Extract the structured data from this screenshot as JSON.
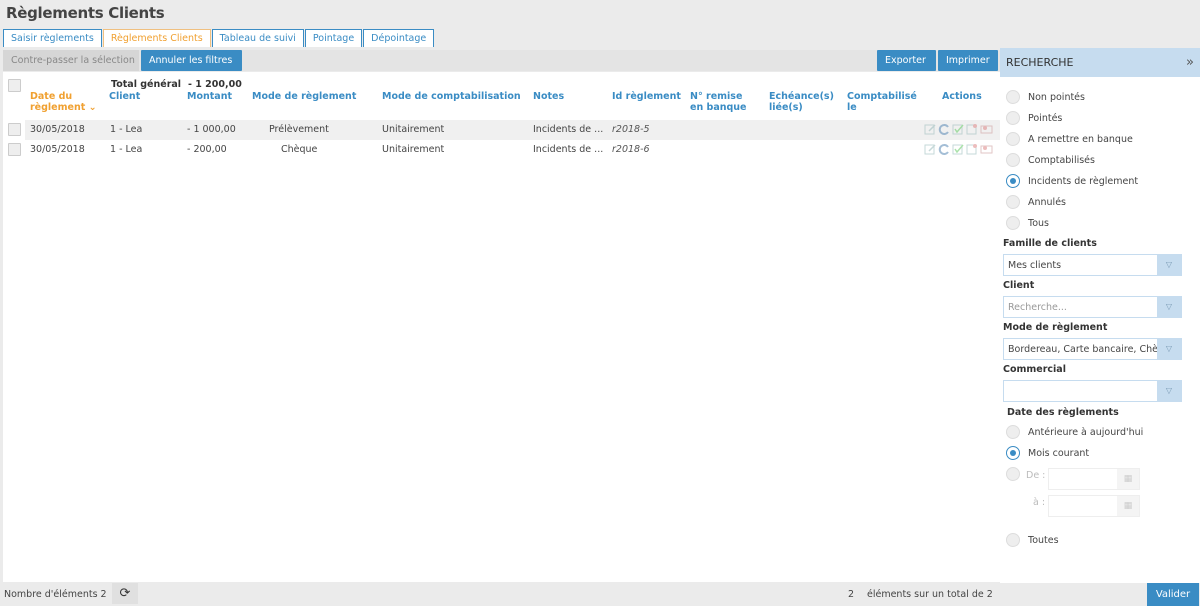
{
  "page": {
    "title": "Règlements Clients"
  },
  "tabs": [
    {
      "label": "Saisir règlements",
      "active": false
    },
    {
      "label": "Règlements Clients",
      "active": true
    },
    {
      "label": "Tableau de suivi",
      "active": false
    },
    {
      "label": "Pointage",
      "active": false
    },
    {
      "label": "Dépointage",
      "active": false
    }
  ],
  "toolbar": {
    "reverse_label": "Contre-passer la sélection",
    "cancel_filters_label": "Annuler les filtres",
    "export_label": "Exporter",
    "print_label": "Imprimer"
  },
  "table": {
    "total_label": "Total général",
    "total_value": "- 1 200,00",
    "columns": [
      "Date du règlement",
      "Client",
      "Montant",
      "Mode de règlement",
      "Mode de comptabilisation",
      "Notes",
      "Id règlement",
      "N° remise en banque",
      "Echéance(s) liée(s)",
      "Comptabilisé le",
      "Actions"
    ],
    "sort_indicator": "⌄",
    "rows": [
      {
        "date": "30/05/2018",
        "client": "1 - Lea",
        "amount": "- 1 000,00",
        "payment_mode": "Prélèvement",
        "accounting_mode": "Unitairement",
        "notes": "Incidents de ...",
        "id": "r2018-5",
        "bank_remit": "",
        "due": "",
        "accounted": ""
      },
      {
        "date": "30/05/2018",
        "client": "1 - Lea",
        "amount": "- 200,00",
        "payment_mode": "Chèque",
        "accounting_mode": "Unitairement",
        "notes": "Incidents de ...",
        "id": "r2018-6",
        "bank_remit": "",
        "due": "",
        "accounted": ""
      }
    ]
  },
  "search": {
    "title": "RECHERCHE",
    "collapse_icon": "»",
    "status_options": [
      {
        "label": "Non pointés",
        "checked": false
      },
      {
        "label": "Pointés",
        "checked": false
      },
      {
        "label": "A remettre en banque",
        "checked": false
      },
      {
        "label": "Comptabilisés",
        "checked": false
      },
      {
        "label": "Incidents de règlement",
        "checked": true
      },
      {
        "label": "Annulés",
        "checked": false
      },
      {
        "label": "Tous",
        "checked": false
      }
    ],
    "family_label": "Famille de clients",
    "family_value": "Mes clients",
    "client_label": "Client",
    "client_placeholder": "Recherche...",
    "mode_label": "Mode de règlement",
    "mode_value": "Bordereau, Carte bancaire, Chèq",
    "commercial_label": "Commercial",
    "commercial_value": "",
    "date_label": "Date des règlements",
    "date_options": [
      {
        "label": "Antérieure à aujourd'hui",
        "checked": false
      },
      {
        "label": "Mois courant",
        "checked": true
      },
      {
        "label": "Toutes",
        "checked": false
      }
    ],
    "from_label": "De :",
    "to_label": "à :",
    "from_value": "",
    "to_value": ""
  },
  "footer": {
    "count_label": "Nombre d'éléments 2",
    "page_count": "2",
    "page_total_label": "éléments sur un total de 2",
    "validate_label": "Valider"
  }
}
